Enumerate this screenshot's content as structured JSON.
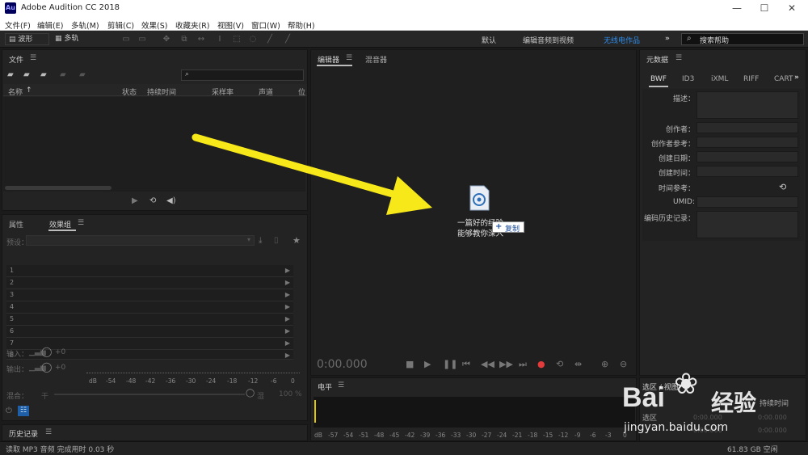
{
  "app": {
    "logo": "Au",
    "title": "Adobe Audition CC 2018"
  },
  "window": {
    "minimize": "—",
    "maximize": "☐",
    "close": "✕"
  },
  "menu": [
    "文件(F)",
    "编辑(E)",
    "多轨(M)",
    "剪辑(C)",
    "效果(S)",
    "收藏夹(R)",
    "视图(V)",
    "窗口(W)",
    "帮助(H)"
  ],
  "toolbar": {
    "waveform": "波形",
    "multitrack": "多轨"
  },
  "workspaces": {
    "default": "默认",
    "edit_video": "编辑音频到视频",
    "wireless": "无线电作品",
    "more": "»"
  },
  "search": {
    "placeholder": "搜索帮助"
  },
  "files_panel": {
    "title": "文件",
    "columns": [
      "名称",
      "状态",
      "持续时间",
      "采样率",
      "声道",
      "位"
    ]
  },
  "props_tab": "属性",
  "effects_tab": "效果组",
  "effects": {
    "preset_label": "预设：",
    "rows": [
      "1",
      "2",
      "3",
      "4",
      "5",
      "6",
      "7",
      "8"
    ],
    "input_label": "输入：",
    "output_label": "输出：",
    "input_db": "+0",
    "output_db": "+0",
    "db_label": "dB",
    "meter_ticks": [
      "-54",
      "-48",
      "-42",
      "-36",
      "-30",
      "-24",
      "-18",
      "-12",
      "-6",
      "0"
    ],
    "mix_label": "混合：",
    "dry": "干",
    "wet": "湿",
    "mix_value": "100 %"
  },
  "editor": {
    "tab_editor": "编辑器",
    "tab_mixer": "混音器",
    "time": "0:00.000",
    "drag_file_line1": "一篇好的经验",
    "drag_file_line2": "能够教你深入",
    "copy_label": "复制"
  },
  "level_panel": {
    "title": "电平",
    "db": "dB",
    "ticks": [
      "-57",
      "-54",
      "-51",
      "-48",
      "-45",
      "-42",
      "-39",
      "-36",
      "-33",
      "-30",
      "-27",
      "-24",
      "-21",
      "-18",
      "-15",
      "-12",
      "-9",
      "-6",
      "-3",
      "0"
    ]
  },
  "metadata_panel": {
    "title": "元数据",
    "tabs": [
      "BWF",
      "ID3",
      "iXML",
      "RIFF",
      "CART"
    ],
    "fields": {
      "desc": "描述：",
      "originator": "创作者：",
      "originator_ref": "创作者参考：",
      "date": "创建日期：",
      "time": "创建时间：",
      "time_ref": "时间参考：",
      "umid": "UMID:",
      "history": "编码历史记录："
    }
  },
  "selection_panel": {
    "title": "选区 / 视图",
    "duration": "持续时间",
    "row_label": "选区",
    "v1": "0:00.000",
    "v2": "0:00.000",
    "v3": "0:00.000",
    "v4": "0:00.000"
  },
  "history_panel": {
    "title": "历史记录"
  },
  "status": {
    "left": "读取 MP3 音频 完成用时 0.03 秒",
    "right": "61.83 GB 空闲"
  },
  "watermark": {
    "brand": "Bai",
    "cn": "经验",
    "url": "jingyan.baidu.com"
  },
  "colors": {
    "accent": "#2d8ceb",
    "arrow": "#f7e81a",
    "record": "#e23b3b"
  }
}
